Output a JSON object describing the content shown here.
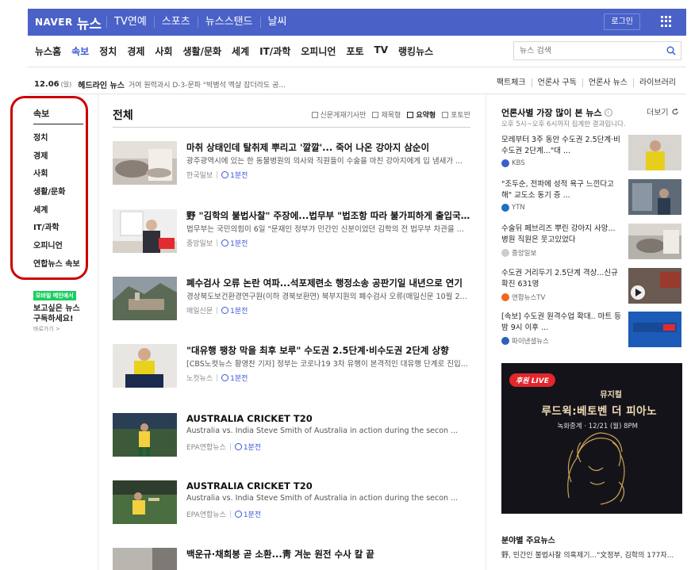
{
  "topbar": {
    "brand": "NAVER",
    "brand_news": "뉴스",
    "nav": [
      "TV연예",
      "스포츠",
      "뉴스스탠드",
      "날씨"
    ],
    "login": "로그인"
  },
  "catnav": {
    "items": [
      "뉴스홈",
      "속보",
      "정치",
      "경제",
      "사회",
      "생활/문화",
      "세계",
      "IT/과학",
      "오피니언",
      "포토",
      "TV",
      "랭킹뉴스"
    ],
    "active": "속보"
  },
  "search": {
    "placeholder": "뉴스 검색"
  },
  "strip": {
    "date": "12.06",
    "dow": "(일)",
    "headline_label": "헤드라인 뉴스",
    "ticker": "거여 원력과시 D-3-문파 \"박병석 멕살 잡더라도 공...",
    "links": [
      "팩트체크",
      "언론사 구독",
      "언론사 뉴스",
      "라이브러리"
    ]
  },
  "left": {
    "title": "속보",
    "menu": [
      "정치",
      "경제",
      "사회",
      "생활/문화",
      "세계",
      "IT/과학",
      "오피니언",
      "연합뉴스 속보"
    ],
    "mobile_badge": "모바일 메인에서",
    "mobile_line1": "보고싶은 뉴스",
    "mobile_line2": "구독하세요!",
    "mobile_link": "바로가기 >"
  },
  "main": {
    "title": "전체",
    "view_options": [
      "신문게재기사만",
      "제목형",
      "요약형",
      "포토만"
    ],
    "articles": [
      {
        "title": "마취 상태인데 탈취제 뿌리고 '깔깔'... 죽어 나온 강아지 삼순이",
        "summary": "광주광역시에 있는 한 동물병원의 의사와 직원들이 수술을 마친 강아지에게 입 냄새가 ...",
        "source": "한국일보",
        "more": "1분전"
      },
      {
        "title": "野 \"김학의 불법사찰\" 주장에...법무부 \"법조항 따라 불가피하게 출입국 여...",
        "summary": "법무부는 국민의힘이 6일 \"문재인 정부가 민간인 신분이었던 김학의 전 법무부 차관을 ...",
        "source": "중앙일보",
        "more": "1분전"
      },
      {
        "title": "폐수검사 오류 논란 여파...석포제련소 행정소송 공판기일 내년으로 연기",
        "summary": "경상북도보건환경연구원(이하 경북보환연) 북부지원의 폐수검사 오류(매일신문 10월 28...",
        "source": "매일신문",
        "more": "1분전"
      },
      {
        "title": "\"대유행 팽창 막을 최후 보루\" 수도권 2.5단계·비수도권 2단계 상향",
        "summary": "[CBS노컷뉴스 황영찬 기자] 정부는 코로나19 3차 유행이 본격적인 대유행 단계로 진입...",
        "source": "노컷뉴스",
        "more": "1분전"
      },
      {
        "title": "AUSTRALIA CRICKET T20",
        "summary": "Australia vs. India Steve Smith of Australia in action during the secon ...",
        "source": "EPA연합뉴스",
        "more": "1분전"
      },
      {
        "title": "AUSTRALIA CRICKET T20",
        "summary": "Australia vs. India Steve Smith of Australia in action during the secon ...",
        "source": "EPA연합뉴스",
        "more": "1분전"
      },
      {
        "title": "백운규·채희봉 곧 소환...靑 겨눈 원전 수사 칼 끝",
        "summary": "",
        "source": "",
        "more": ""
      }
    ]
  },
  "right": {
    "title": "언론사별 가장 많이 본 뉴스",
    "info": "i",
    "subtitle": "오후 5시~오후 6시까지 집계한 결과입니다.",
    "refresh": "더보기",
    "items": [
      {
        "title": "모레부터 3주 동안 수도권 2.5단계·비수도권 2단계...\"대 ...",
        "source": "KBS",
        "dot": "#3a5fcd"
      },
      {
        "title": "\"조두순, 전파에 성적 욕구 느낀다고 해\" 교도소 동기 증 ...",
        "source": "YTN",
        "dot": "#1d6fc2"
      },
      {
        "title": "수술뒤 페브리즈 뿌린 강아지 사망... 병원 직원은 웃고있었다",
        "source": "중앙일보",
        "dot": "#cccccc"
      },
      {
        "title": "수도권 거리두기 2.5단계 격상...신규 확진 631명",
        "source": "연합뉴스TV",
        "dot": "#f06820"
      },
      {
        "title": "[속보] 수도권 원격수업 확대.. 마트 등 밤 9시 이후 ...",
        "source": "파이낸셜뉴스",
        "dot": "#2b63b8"
      }
    ],
    "ad": {
      "live": "후원 LIVE",
      "t1": "뮤지컬",
      "t2": "루드윅:베토벤 더 피아노",
      "t3": "녹화중계 · 12/21 (월) 8PM"
    },
    "bottom_title": "분야별 주요뉴스",
    "bottom_text": "野, 민간인 불법사찰 의혹제기...\"文정부, 김학의 177자..."
  }
}
